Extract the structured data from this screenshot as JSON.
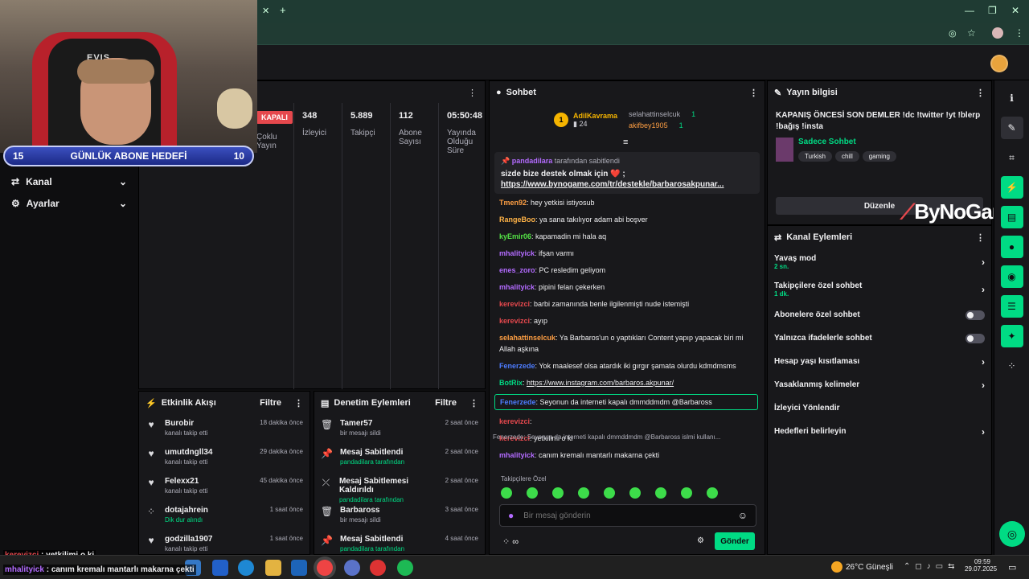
{
  "webcam": {
    "goal_left": "15",
    "goal_label": "GÜNLÜK ABONE HEDEFİ",
    "goal_right": "10",
    "chair_brand": "EVIS"
  },
  "nav": [
    {
      "label": "Kanal"
    },
    {
      "label": "Ayarlar"
    }
  ],
  "stats": {
    "live_badge": "KAPALI",
    "live_label": "Çoklu Yayın",
    "items": [
      {
        "value": "348",
        "label": "İzleyici"
      },
      {
        "value": "5.889",
        "label": "Takipçi"
      },
      {
        "value": "112",
        "label": "Abone Sayısı"
      },
      {
        "value": "05:50:48",
        "label": "Yayında Olduğu Süre"
      }
    ]
  },
  "activity": {
    "title": "Etkinlik Akışı",
    "filter": "Filtre",
    "items": [
      {
        "name": "Burobir",
        "sub": "kanalı takip etti",
        "time": "18 dakika önce",
        "icon": "heart-icon"
      },
      {
        "name": "umutdngll34",
        "sub": "kanalı takip etti",
        "time": "29 dakika önce",
        "icon": "heart-icon"
      },
      {
        "name": "Felexx21",
        "sub": "kanalı takip etti",
        "time": "45 dakika önce",
        "icon": "heart-icon"
      },
      {
        "name": "dotajahrein",
        "sub": "Dik dur alındı",
        "time": "1 saat önce",
        "icon": "points-icon"
      },
      {
        "name": "godzilla1907",
        "sub": "kanalı takip etti",
        "time": "1 saat önce",
        "icon": "heart-icon"
      }
    ]
  },
  "moderation": {
    "title": "Denetim Eylemleri",
    "filter": "Filtre",
    "items": [
      {
        "name": "Tamer57",
        "sub": "bir mesajı sildi",
        "time": "2 saat önce",
        "icon": "trash-icon"
      },
      {
        "name": "Mesaj Sabitlendi",
        "sub": "pandadilara tarafından",
        "time": "2 saat önce",
        "icon": "pin-icon"
      },
      {
        "name": "Mesaj Sabitlemesi Kaldırıldı",
        "sub": "pandadilara tarafından",
        "time": "2 saat önce",
        "icon": "unpin-icon"
      },
      {
        "name": "Barbaross",
        "sub": "bir mesajı sildi",
        "time": "3 saat önce",
        "icon": "trash-icon"
      },
      {
        "name": "Mesaj Sabitlendi",
        "sub": "pandadilara tarafından",
        "time": "4 saat önce",
        "icon": "pin-icon"
      }
    ]
  },
  "chat": {
    "title": "Sohbet",
    "leaderboard": {
      "top_rank": "1",
      "top_name": "AdilKavrama",
      "top_count": "24",
      "others": [
        {
          "name": "selahattinselcuk",
          "count": "1"
        },
        {
          "name": "akifbey1905",
          "count": "1"
        }
      ]
    },
    "pinned": {
      "by": "pandadilara",
      "by_suffix": "tarafından sabitlendi",
      "text": "sizde bize destek olmak için ❤️ ;",
      "link": "https://www.bynogame.com/tr/destekle/barbarosakpunar..."
    },
    "messages": [
      {
        "user": "Tmen92",
        "color": "#ff9f43",
        "text": "hey yetkisi istiyosub"
      },
      {
        "user": "RangeBoo",
        "color": "#ffb347",
        "text": "ya sana takılıyor adam abi boşver"
      },
      {
        "user": "kyEmir06",
        "color": "#54e346",
        "text": "kapamadin mi hala aq"
      },
      {
        "user": "mhalityick",
        "color": "#b36bff",
        "text": "ifşan varmı"
      },
      {
        "user": "enes_zoro",
        "color": "#b36bff",
        "text": "PC resledim geliyom"
      },
      {
        "user": "mhalityick",
        "color": "#b36bff",
        "text": "pipini felan çekerken"
      },
      {
        "user": "kerevizci",
        "color": "#e5484d",
        "text": "barbi zamanında benle ilgilenmişti nude istemişti"
      },
      {
        "user": "kerevizci",
        "color": "#e5484d",
        "text": "ayıp"
      },
      {
        "user": "selahattinselcuk",
        "color": "#ff9f43",
        "text": "Ya Barbaros'un o yaptıkları Content yapıp yapacak biri mi Allah aşkına"
      },
      {
        "user": "Fenerzede",
        "color": "#4d7cff",
        "text": "Yok maalesef olsa atardık iki gırgır şamata olurdu kdmdmsms"
      },
      {
        "user": "BotRix",
        "color": "#00db84",
        "text": "https://www.instagram.com/barbaros.akpunar/"
      },
      {
        "user": "Fenerzede",
        "color": "#4d7cff",
        "text": "Seyonun da interneti kapalı dmmddmdm @Barbaross"
      },
      {
        "user": "kerevizci",
        "color": "#e5484d",
        "text": ""
      },
      {
        "user": "kerevizci",
        "color": "#e5484d",
        "text": "yetkilimi o ki"
      },
      {
        "user": "mhalityick",
        "color": "#b36bff",
        "text": "canım kremalı mantarlı makarna çekti"
      }
    ],
    "reply_preview": "Fenerzede: Seyonun da interneti kapalı dmmddmdm @Barbaross islmi kullanı...",
    "followers_only": "Takipçilere Özel",
    "input_placeholder": "Bir mesaj gönderin",
    "send_label": "Gönder"
  },
  "stream_info": {
    "title": "Yayın bilgisi",
    "stream_title": "KAPANIŞ ÖNCESİ SON DEMLER !dc !twitter !yt !blerp !bağış !insta",
    "category": "Sadece Sohbet",
    "tags": [
      "Turkish",
      "chill",
      "gaming"
    ],
    "edit_label": "Düzenle",
    "watermark": "ByNoGame"
  },
  "channel_actions": {
    "title": "Kanal Eylemleri",
    "items": [
      {
        "label": "Yavaş mod",
        "sub": "2 sn.",
        "control": "chevron"
      },
      {
        "label": "Takipçilere özel sohbet",
        "sub": "1 dk.",
        "control": "chevron"
      },
      {
        "label": "Abonelere özel sohbet",
        "sub": "",
        "control": "toggle"
      },
      {
        "label": "Yalnızca ifadelerle sohbet",
        "sub": "",
        "control": "toggle"
      },
      {
        "label": "Hesap yaşı kısıtlaması",
        "sub": "",
        "control": "chevron"
      },
      {
        "label": "Yasaklanmış kelimeler",
        "sub": "",
        "control": "chevron"
      },
      {
        "label": "İzleyici Yönlendir",
        "sub": "",
        "control": "none"
      },
      {
        "label": "Hedefleri belirleyin",
        "sub": "",
        "control": "chevron"
      }
    ]
  },
  "overlay_chat": [
    {
      "user": "kerevizci",
      "text": "yetkilimi o ki"
    },
    {
      "user": "mhalityick",
      "text": "canım kremalı mantarlı makarna çekti"
    }
  ],
  "taskbar": {
    "weather": "26°C Güneşli",
    "time": "09:59",
    "date": "29.07.2025"
  },
  "colors": {
    "accent": "#00db84",
    "panel": "#18181b",
    "bg": "#0e0e10"
  }
}
